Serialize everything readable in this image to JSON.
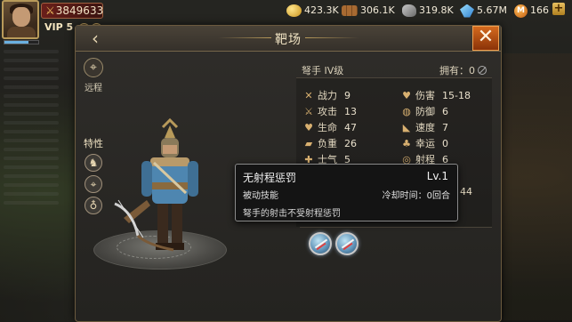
{
  "hud": {
    "power": "3849633",
    "vip": "VIP 5",
    "resources": [
      {
        "icon": "gold-coin-icon",
        "value": "423.3K"
      },
      {
        "icon": "wood-icon",
        "value": "306.1K"
      },
      {
        "icon": "stone-icon",
        "value": "319.8K"
      },
      {
        "icon": "crystal-icon",
        "value": "5.67M"
      },
      {
        "icon": "gem-icon",
        "value": "166"
      }
    ],
    "gem_symbol": "M",
    "plus": "+"
  },
  "panel": {
    "title": "靶场",
    "back": "‹",
    "close": "✕"
  },
  "rail": {
    "type_label": "远程",
    "trait_label": "特性"
  },
  "unit": {
    "name": "弩手  IV级",
    "owned_label": "拥有：0"
  },
  "stats": [
    {
      "label": "战力",
      "value": "9"
    },
    {
      "label": "伤害",
      "value": "15-18"
    },
    {
      "label": "攻击",
      "value": "13"
    },
    {
      "label": "防御",
      "value": "6"
    },
    {
      "label": "生命",
      "value": "47"
    },
    {
      "label": "速度",
      "value": "7"
    },
    {
      "label": "负重",
      "value": "26"
    },
    {
      "label": "幸运",
      "value": "0"
    },
    {
      "label": "士气",
      "value": "5"
    },
    {
      "label": "射程",
      "value": "6"
    }
  ],
  "hidden_stat_value": "44",
  "tooltip": {
    "title": "无射程惩罚",
    "level": "Lv.1",
    "type": "被动技能",
    "cooldown": "冷却时间：0回合",
    "desc": "弩手的射击不受射程惩罚"
  }
}
